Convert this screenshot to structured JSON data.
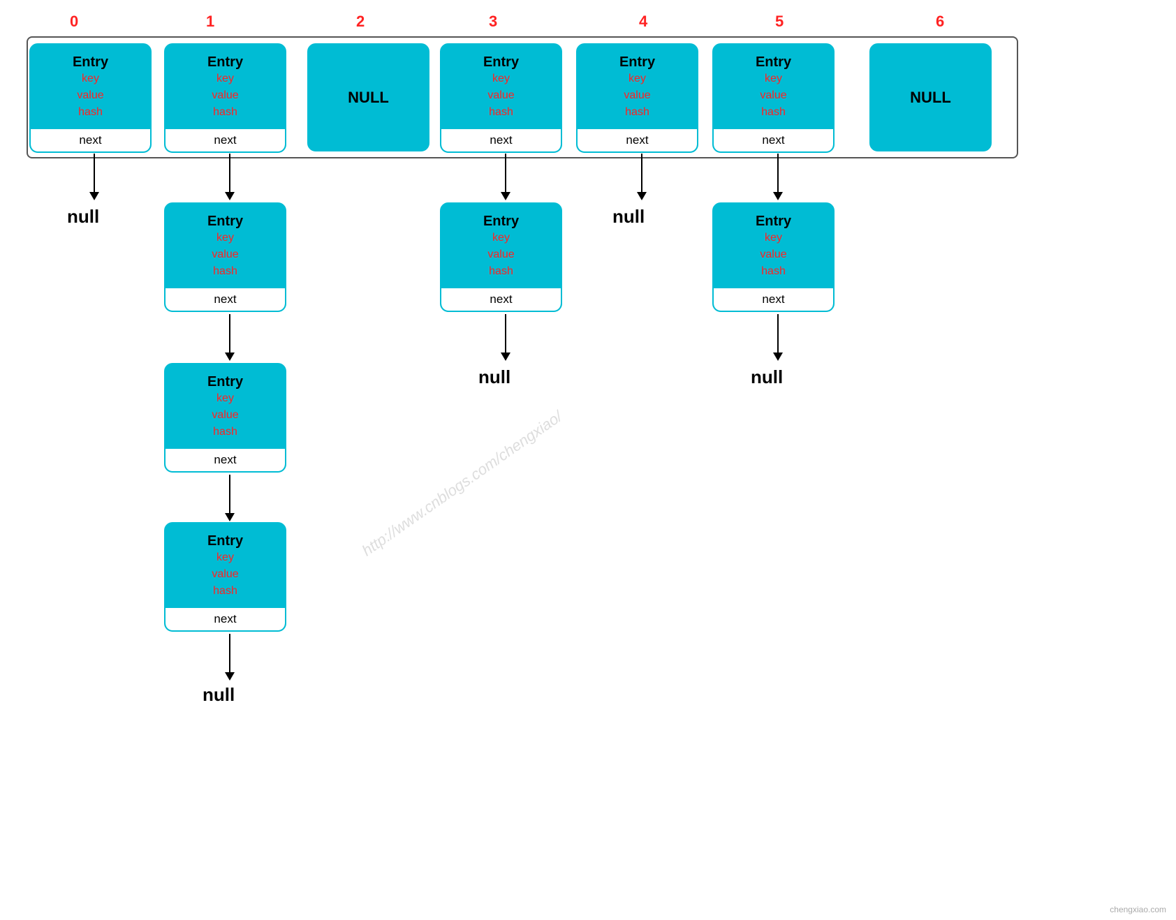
{
  "indices": [
    "0",
    "1",
    "2",
    "3",
    "4",
    "5",
    "6"
  ],
  "indexColors": [
    "#ff2222",
    "#ff2222",
    "#ff2222",
    "#ff2222",
    "#ff2222",
    "#ff2222",
    "#ff2222"
  ],
  "topRow": [
    {
      "type": "entry",
      "fields": [
        "key",
        "value",
        "hash"
      ]
    },
    {
      "type": "entry",
      "fields": [
        "key",
        "value",
        "hash"
      ]
    },
    {
      "type": "null_cell"
    },
    {
      "type": "entry",
      "fields": [
        "key",
        "value",
        "hash"
      ]
    },
    {
      "type": "entry",
      "fields": [
        "key",
        "value",
        "hash"
      ]
    },
    {
      "type": "entry",
      "fields": [
        "key",
        "value",
        "hash"
      ]
    },
    {
      "type": "null_cell"
    }
  ],
  "labels": {
    "entry": "Entry",
    "null": "NULL",
    "next": "next",
    "null_text": "null"
  },
  "watermark": "http://www.cnblogs.com/chengxiao/",
  "branding": "chengxiao.com"
}
